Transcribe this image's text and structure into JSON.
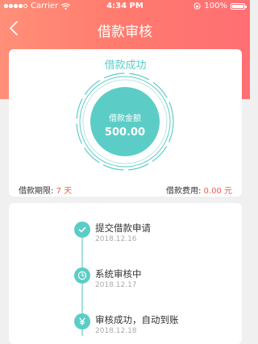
{
  "status_bar": {
    "carrier": "Carrier",
    "time": "4:34 PM",
    "battery": "100%"
  },
  "nav": {
    "title": "借款审核"
  },
  "result": {
    "status": "借款成功",
    "amount_label": "借款金额",
    "amount_value": "500.00",
    "term_label": "借款期限:",
    "term_value": "7 天",
    "fee_label": "借款费用:",
    "fee_value": "0.00 元"
  },
  "timeline": {
    "steps": [
      {
        "title": "提交借款申请",
        "date": "2018.12.16",
        "icon": "check-icon"
      },
      {
        "title": "系统审核中",
        "date": "2018.12.17",
        "icon": "clock-icon"
      },
      {
        "title": "审核成功，自动到账",
        "date": "2018.12.18",
        "icon": "yen-icon"
      }
    ]
  },
  "colors": {
    "header_gradient_start": "#ff8f78",
    "header_gradient_end": "#ff6f74",
    "accent_teal": "#5ccdc6",
    "highlight_red": "#f25a51",
    "background": "#f0f0f0"
  }
}
